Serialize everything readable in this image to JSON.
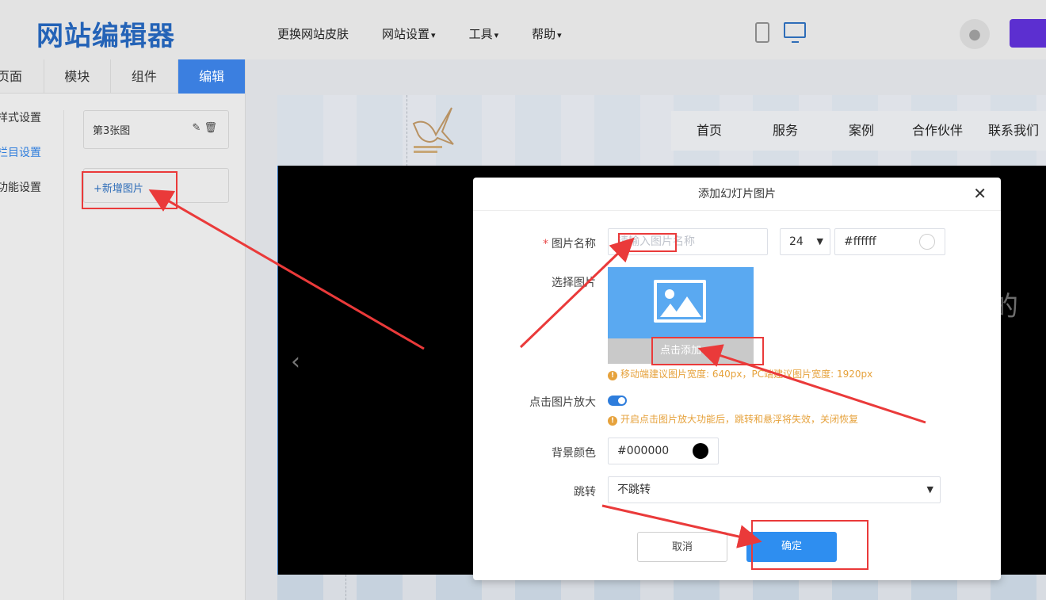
{
  "header": {
    "logo": "网站编辑器",
    "nav": [
      {
        "label": "更换网站皮肤"
      },
      {
        "label": "网站设置"
      },
      {
        "label": "工具"
      },
      {
        "label": "帮助"
      }
    ]
  },
  "left": {
    "tabs": [
      "页面",
      "模块",
      "组件",
      "编辑"
    ],
    "menu": [
      "样式设置",
      "栏目设置",
      "功能设置"
    ],
    "image_item": "第3张图",
    "add_button": "+新增图片"
  },
  "preview": {
    "nav": [
      "首页",
      "服务",
      "案例",
      "合作伙伴",
      "联系我们"
    ],
    "banner_char": "的"
  },
  "modal": {
    "title": "添加幻灯片图片",
    "name_label": "图片名称",
    "name_placeholder": "请输入图片名称",
    "font_size": "24",
    "text_color": "#ffffff",
    "image_label": "选择图片",
    "add_image": "点击添加",
    "image_hint": "移动端建议图片宽度: 640px，PC端建议图片宽度: 1920px",
    "zoom_label": "点击图片放大",
    "zoom_hint": "开启点击图片放大功能后，跳转和悬浮将失效，关闭恢复",
    "bg_label": "背景颜色",
    "bg_color": "#000000",
    "jump_label": "跳转",
    "jump_value": "不跳转",
    "cancel": "取消",
    "confirm": "确定"
  },
  "colors": {
    "accent": "#2e7ddc",
    "annotation": "#ea3a3a",
    "hint": "#e6a23c"
  }
}
